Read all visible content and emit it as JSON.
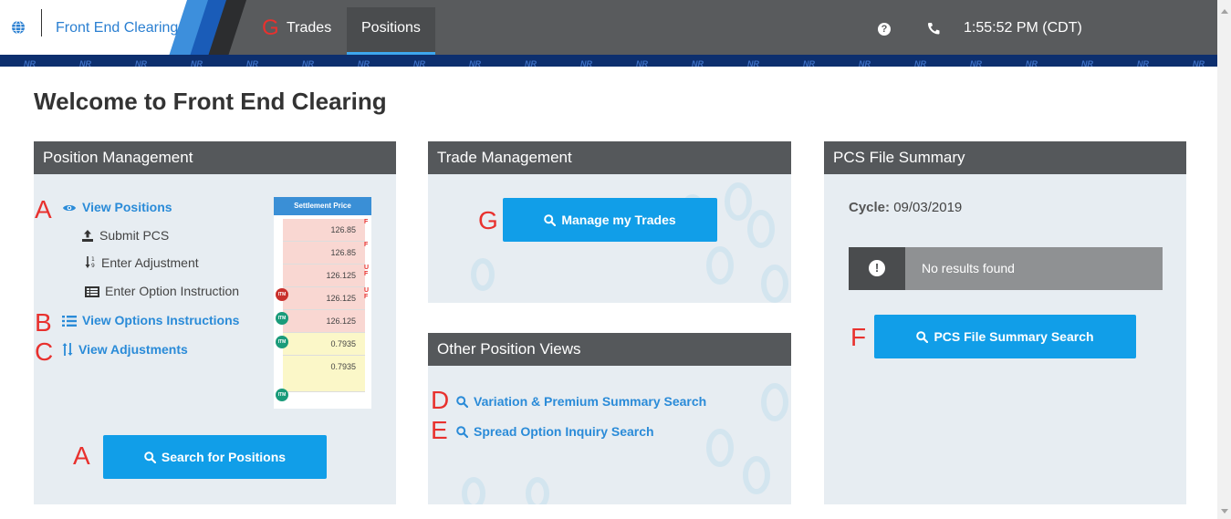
{
  "header": {
    "app_title": "Front End Clearing",
    "annotation_marker": "G",
    "nav": {
      "trades": "Trades",
      "positions": "Positions"
    },
    "help_icon_glyph": "?",
    "clock": "1:55:52 PM (CDT)",
    "band_label": "NR"
  },
  "page": {
    "title": "Welcome to Front End Clearing"
  },
  "position_management": {
    "title": "Position Management",
    "links": {
      "view_positions": "View Positions",
      "submit_pcs": "Submit PCS",
      "enter_adjustment": "Enter Adjustment",
      "enter_option_instruction": "Enter Option Instruction",
      "view_options_instructions": "View Options Instructions",
      "view_adjustments": "View Adjustments"
    },
    "markers": {
      "view_positions": "A",
      "view_options_instructions": "B",
      "view_adjustments": "C",
      "search_button": "A"
    },
    "thumbnail": {
      "header": "Settlement Price",
      "rows": [
        "126.85",
        "126.85",
        "126.125",
        "126.125",
        "126.125",
        "0.7935",
        "0.7935"
      ],
      "side_marks": [
        "F",
        "F",
        "U F",
        "U F",
        "",
        "",
        ""
      ],
      "badge": "ITM"
    },
    "search_button": "Search for Positions"
  },
  "trade_management": {
    "title": "Trade Management",
    "marker": "G",
    "button": "Manage my Trades"
  },
  "other_position_views": {
    "title": "Other Position Views",
    "links": {
      "variation_premium": "Variation & Premium Summary Search",
      "spread_option": "Spread Option Inquiry Search"
    },
    "markers": {
      "variation_premium": "D",
      "spread_option": "E"
    }
  },
  "pcs_file_summary": {
    "title": "PCS File Summary",
    "cycle_label": "Cycle:",
    "cycle_value": "09/03/2019",
    "alert_icon_glyph": "!",
    "alert_text": "No results found",
    "marker": "F",
    "button": "PCS File Summary Search"
  },
  "colors": {
    "accent_blue": "#119ee8",
    "link_blue": "#2a8bd8",
    "header_gray": "#595b5d",
    "panel_bg": "#e7edf2",
    "marker_red": "#e8312e"
  }
}
